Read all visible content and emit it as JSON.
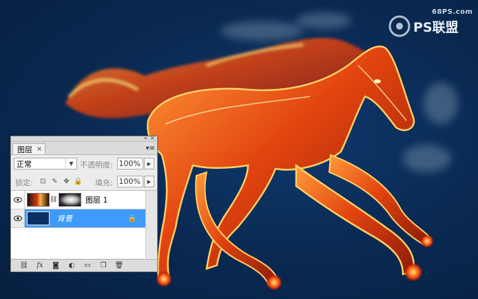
{
  "watermark": {
    "site": "68PS.com",
    "brand": "PS联盟"
  },
  "panel": {
    "tab_label": "图层",
    "tab_close": "×",
    "window_controls": [
      "«",
      "×"
    ],
    "blend_mode": "正常",
    "opacity_label": "不透明度:",
    "opacity_value": "100%",
    "lock_label": "锁定:",
    "fill_label": "填充:",
    "fill_value": "100%",
    "layers": [
      {
        "name": "图层 1",
        "visible": true,
        "selected": false,
        "has_mask": true
      },
      {
        "name": "背景",
        "visible": true,
        "selected": true,
        "locked": true
      }
    ],
    "bottom_icons": [
      "link-layers-icon",
      "fx-icon",
      "add-mask-icon",
      "adjustment-layer-icon",
      "group-folder-icon",
      "new-layer-icon",
      "trash-icon"
    ],
    "bottom_fx": "fx"
  },
  "colors": {
    "background": "#0a2b55",
    "selection": "#3e9bfb",
    "fire_bright": "#ffd166",
    "fire_mid": "#ff6a1a",
    "fire_dark": "#c2230a"
  }
}
